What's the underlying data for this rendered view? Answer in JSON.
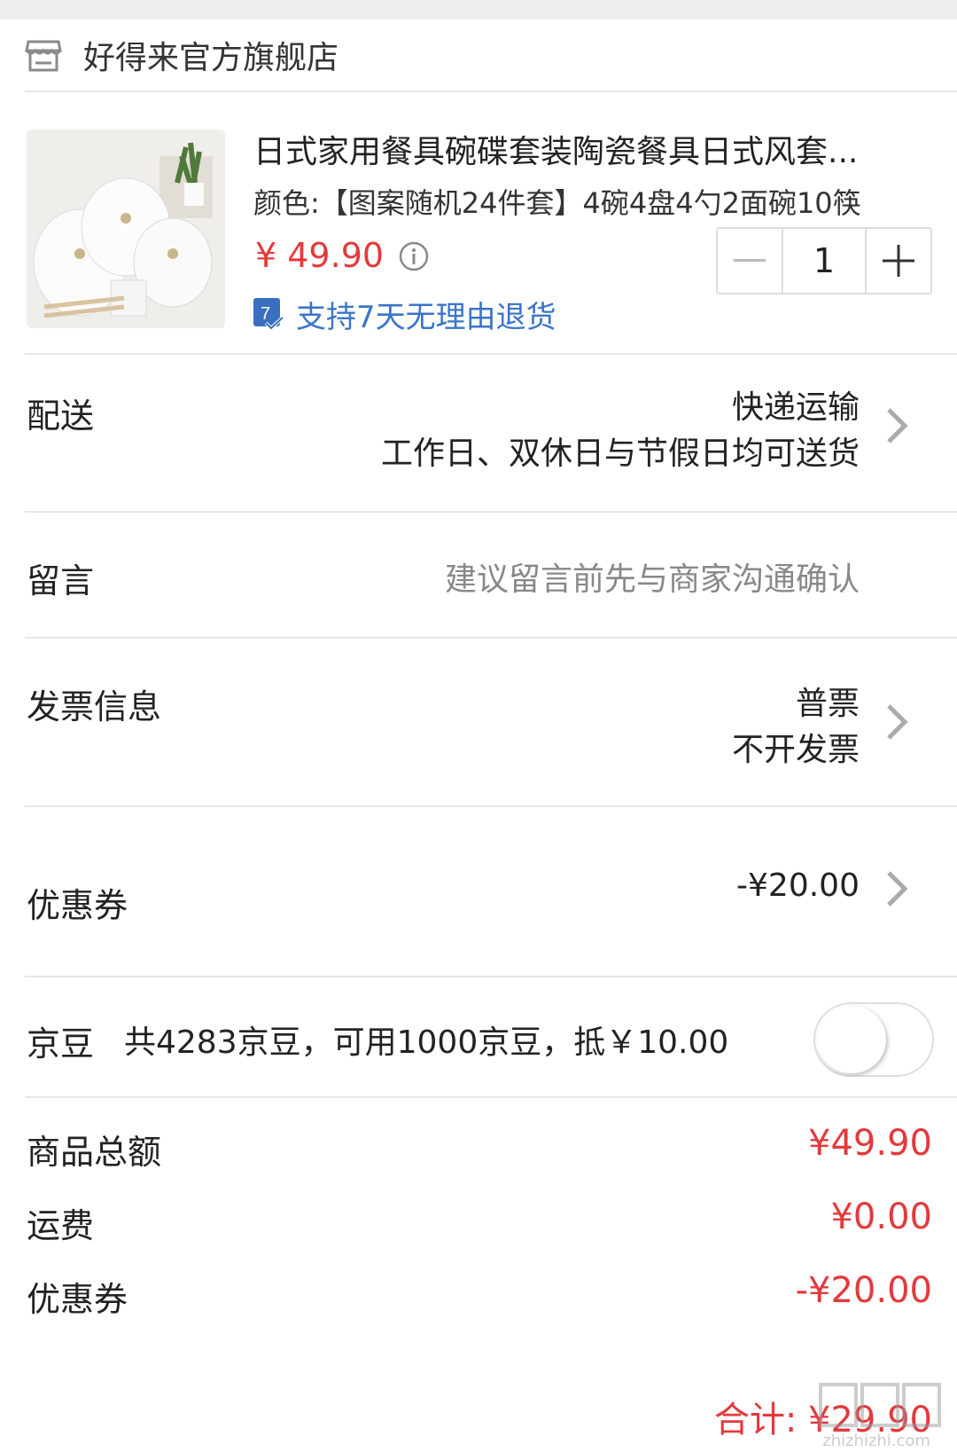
{
  "shop": {
    "name": "好得来官方旗舰店",
    "icon": "store-icon"
  },
  "product": {
    "title": "日式家用餐具碗碟套装陶瓷餐具日式风套...",
    "spec": "颜色:【图案随机24件套】4碗4盘4勺2面碗10筷",
    "price": "¥ 49.90",
    "quantity": "1",
    "return_policy": "支持7天无理由退货",
    "return_badge": "7"
  },
  "delivery": {
    "label": "配送",
    "method": "快递运输",
    "detail": "工作日、双休日与节假日均可送货"
  },
  "message": {
    "label": "留言",
    "placeholder": "建议留言前先与商家沟通确认"
  },
  "invoice": {
    "label": "发票信息",
    "type": "普票",
    "detail": "不开发票"
  },
  "coupon": {
    "label": "优惠券",
    "value": "-¥20.00"
  },
  "jingdou": {
    "label": "京豆",
    "text": "共4283京豆，可用1000京豆，抵￥10.00",
    "enabled": false
  },
  "summary": [
    {
      "label": "商品总额",
      "value": "¥49.90"
    },
    {
      "label": "运费",
      "value": "¥0.00"
    },
    {
      "label": "优惠券",
      "value": "-¥20.00"
    }
  ],
  "total": "合计: ¥29.90",
  "watermark": "zhizhizhi.com",
  "colors": {
    "price_red": "#e4393c",
    "link_blue": "#3a74c8",
    "divider": "#e6e6e6"
  }
}
